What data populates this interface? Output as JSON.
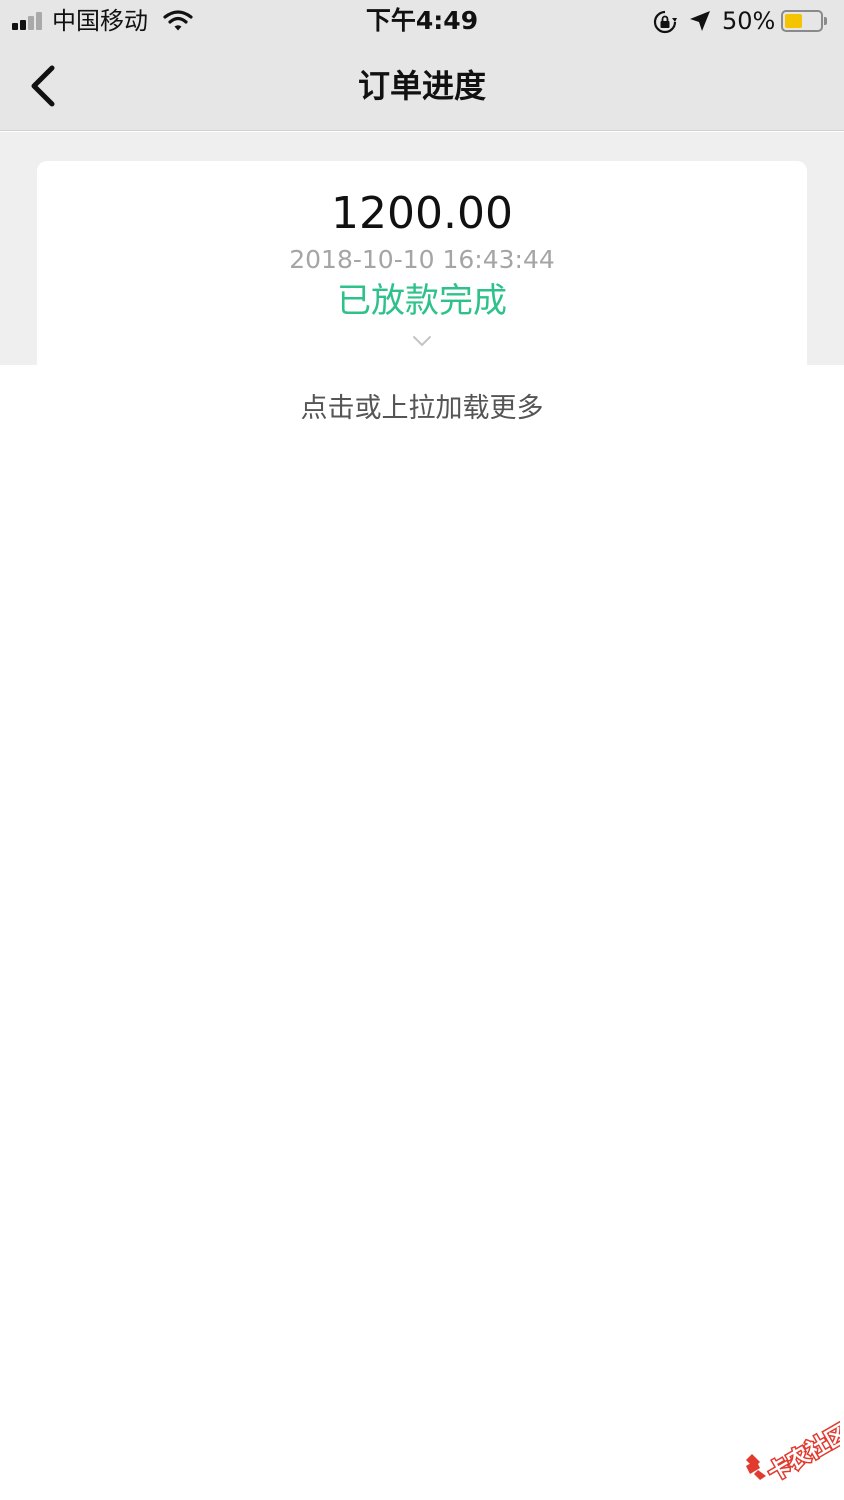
{
  "status_bar": {
    "carrier": "中国移动",
    "time": "下午4:49",
    "battery_percent_label": "50%",
    "battery_level": 0.5,
    "icons": [
      "signal-icon",
      "wifi-icon",
      "orientation-lock-icon",
      "location-icon",
      "battery-icon"
    ]
  },
  "nav": {
    "title": "订单进度",
    "back_icon": "chevron-left-icon"
  },
  "order": {
    "amount": "1200.00",
    "datetime": "2018-10-10 16:43:44",
    "status": "已放款完成",
    "expand_icon": "chevron-down-icon"
  },
  "load_more": "点击或上拉加载更多",
  "watermark": {
    "text": "卡农社区"
  },
  "colors": {
    "status_green": "#2ec28a",
    "battery_yellow": "#f5c400",
    "nav_bg": "#e6e6e6",
    "content_bg": "#efefef"
  }
}
